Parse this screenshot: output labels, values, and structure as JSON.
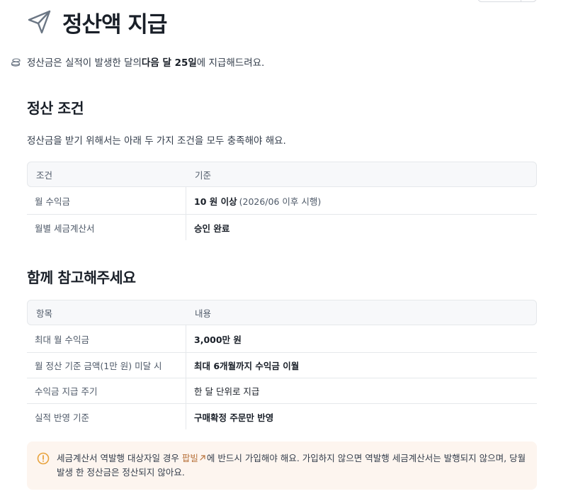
{
  "header": {
    "title": "정산액 지급",
    "icon": "paper-plane-icon"
  },
  "intro": {
    "icon": "coin-stack-icon",
    "prefix": "정산금은 실적이 발생한 달의 ",
    "highlight": "다음 달 25일",
    "suffix": " 에 지급해드려요."
  },
  "conditions": {
    "title": "정산 조건",
    "description": "정산금을 받기 위해서는 아래 두 가지 조건을 모두 충족해야 해요.",
    "headers": [
      "조건",
      "기준"
    ],
    "rows": [
      {
        "label": "월 수익금",
        "value": "10 원 이상",
        "note": "(2026/06 이후 시행)"
      },
      {
        "label": "월별 세금계산서",
        "value": "승인 완료",
        "note": ""
      }
    ]
  },
  "reference": {
    "title": "함께 참고해주세요",
    "headers": [
      "항목",
      "내용"
    ],
    "rows": [
      {
        "label": "최대 월 수익금",
        "value": "3,000만 원",
        "bold": true
      },
      {
        "label": "월 정산 기준 금액(1만 원) 미달 시",
        "value": "최대 6개월까지 수익금 이월",
        "bold": true
      },
      {
        "label": "수익금 지급 주기",
        "value": "한 달 단위로 지급",
        "bold": false
      },
      {
        "label": "실적 반영 기준",
        "value": "구매확정 주문만 반영",
        "bold": true
      }
    ]
  },
  "notice": {
    "icon": "warning-circle-icon",
    "before_link": "세금계산서 역발행 대상자일 경우 ",
    "link": "팝빌",
    "link_icon": "external-link-icon",
    "after_link": "에 반드시 가입해야 해요. 가입하지 않으면 역발행 세금계산서는 발행되지 않으며, 당월 발생 한 정산금은 정산되지 않아요."
  },
  "colors": {
    "text": "#191f28",
    "muted": "#4e5968",
    "link": "#b8733c",
    "notice_bg": "#fdf5ef",
    "warning": "#e8a33d",
    "table_header_bg": "#f7f8fa"
  }
}
